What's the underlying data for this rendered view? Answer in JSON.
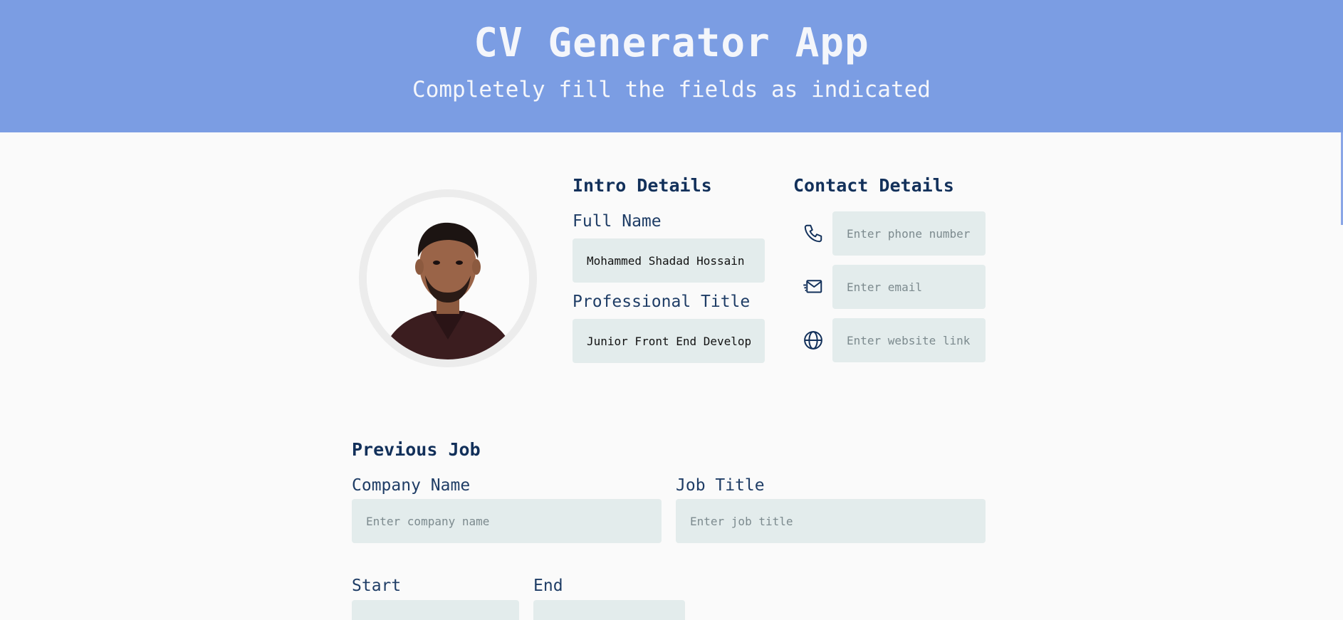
{
  "header": {
    "title": "CV Generator App",
    "subtitle": "Completely fill the fields as indicated"
  },
  "intro": {
    "heading": "Intro Details",
    "full_name_label": "Full Name",
    "full_name_value": "Mohammed Shadad Hossain",
    "professional_title_label": "Professional Title",
    "professional_title_value": "Junior Front End Developer"
  },
  "contact": {
    "heading": "Contact Details",
    "phone_placeholder": "Enter phone number",
    "email_placeholder": "Enter email",
    "website_placeholder": "Enter website link",
    "icons": [
      "phone-icon",
      "email-icon",
      "globe-icon"
    ]
  },
  "previous_job": {
    "heading": "Previous Job",
    "company_label": "Company Name",
    "company_placeholder": "Enter company name",
    "job_title_label": "Job Title",
    "job_title_placeholder": "Enter job title",
    "start_label": "Start",
    "end_label": "End"
  },
  "colors": {
    "header_bg": "#7b9de3",
    "input_bg": "#e3ecec",
    "heading": "#12305a"
  }
}
